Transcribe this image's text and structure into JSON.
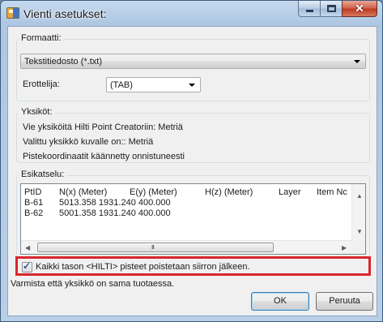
{
  "window": {
    "title": "Vienti asetukset:",
    "close_glyph": "✕"
  },
  "format": {
    "group_label": "Formaatti:",
    "selected": "Tekstitiedosto (*.txt)",
    "separator_label": "Erottelija:",
    "separator_selected": "(TAB)"
  },
  "units": {
    "group_label": "Yksiköt:",
    "lines": [
      "Vie yksiköitä Hilti Point Creatoriin: Metriä",
      "Valittu yksikkö kuvalle on:: Metriä",
      "Pistekoordinaatit käännetty onnistuneesti"
    ]
  },
  "preview": {
    "group_label": "Esikatselu:",
    "columns": [
      "PtID",
      "N(x) (Meter)",
      "E(y) (Meter)",
      "H(z) (Meter)",
      "Layer",
      "Item Nc"
    ],
    "rows": [
      [
        "B-61",
        "5013.358 1931.240 400.000"
      ],
      [
        "B-62",
        "5001.358 1931.240 400.000"
      ]
    ],
    "scroll_up": "▲",
    "scroll_down": "▼",
    "scroll_left": "◀",
    "scroll_right": "▶",
    "thumb_grip": "III"
  },
  "delete_option": {
    "checked": true,
    "check_glyph": "✓",
    "label": "Kaikki tason <HILTI> pisteet poistetaan siirron jälkeen."
  },
  "warning": "Varmista että yksikkö on sama tuotaessa.",
  "buttons": {
    "ok": "OK",
    "cancel": "Peruuta"
  }
}
